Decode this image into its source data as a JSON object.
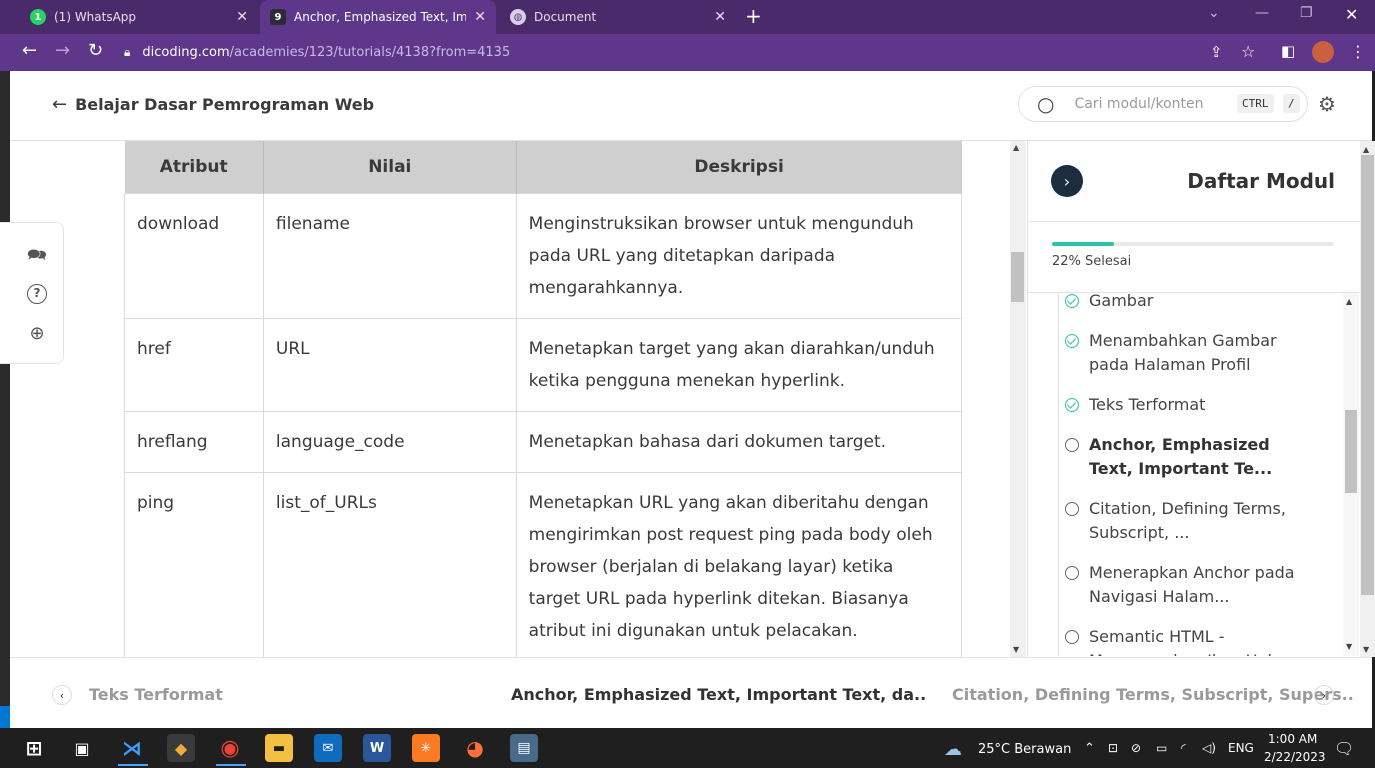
{
  "browser": {
    "tabs": [
      {
        "title": "(1) WhatsApp",
        "favicon": "whatsapp-icon",
        "color": "#25d366"
      },
      {
        "title": "Anchor, Emphasized Text, Import",
        "favicon": "dicoding-icon",
        "color": "#2a2a3a"
      },
      {
        "title": "Document",
        "favicon": "globe-icon",
        "color": "#6a6a6a"
      }
    ],
    "url_host": "dicoding.com",
    "url_path": "/academies/123/tutorials/4138?from=4135"
  },
  "header": {
    "course_title": "Belajar Dasar Pemrograman Web",
    "search_placeholder": "Cari modul/konten",
    "kbd_ctrl": "CTRL",
    "kbd_slash": "/"
  },
  "table": {
    "headers": [
      "Atribut",
      "Nilai",
      "Deskripsi"
    ],
    "rows": [
      {
        "attr": "download",
        "value": "filename",
        "desc": "Menginstruksikan browser untuk mengunduh pada URL yang ditetapkan daripada mengarahkannya."
      },
      {
        "attr": "href",
        "value": "URL",
        "desc": "Menetapkan target yang akan diarahkan/unduh ketika pengguna menekan hyperlink."
      },
      {
        "attr": "hreflang",
        "value": "language_code",
        "desc": "Menetapkan bahasa dari dokumen target."
      },
      {
        "attr": "ping",
        "value": "list_of_URLs",
        "desc": "Menetapkan URL yang akan diberitahu dengan mengirimkan post request ping pada body oleh browser (berjalan di belakang layar) ketika target URL pada hyperlink ditekan. Biasanya atribut ini digunakan untuk pelacakan."
      }
    ]
  },
  "panel": {
    "title": "Daftar Modul",
    "progress_label": "22% Selesai",
    "progress": 0.22,
    "modules": [
      {
        "label": "Gambar",
        "status": "done"
      },
      {
        "label": "Menambahkan Gambar pada Halaman Profil",
        "status": "done"
      },
      {
        "label": "Teks Terformat",
        "status": "done"
      },
      {
        "label": "Anchor, Emphasized Text, Important Te...",
        "status": "current"
      },
      {
        "label": "Citation, Defining Terms, Subscript, ...",
        "status": "todo"
      },
      {
        "label": "Menerapkan Anchor pada Navigasi Halam...",
        "status": "todo"
      },
      {
        "label": "Semantic HTML - Menggunakan Ikon Hal...",
        "status": "todo"
      }
    ]
  },
  "footer": {
    "prev": "Teks Terformat",
    "current": "Anchor, Emphasized Text, Important Text, da..",
    "next": "Citation, Defining Terms, Subscript, Supers.."
  },
  "taskbar": {
    "weather": "25°C  Berawan",
    "lang": "ENG",
    "time": "1:00 AM",
    "date": "2/22/2023"
  },
  "colors": {
    "accent": "#2dc3ab",
    "browser": "#5e378a",
    "tabbar": "#4a2a6a"
  }
}
